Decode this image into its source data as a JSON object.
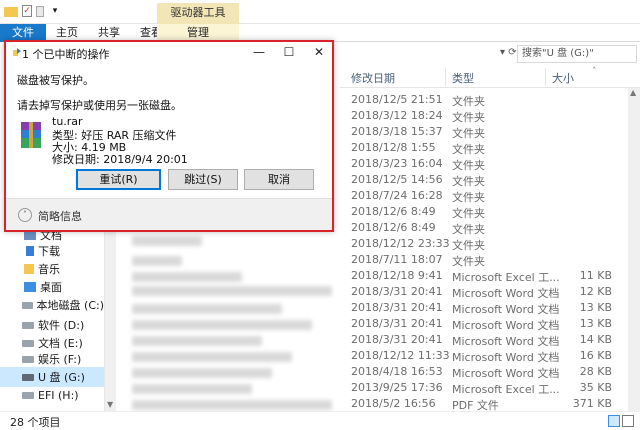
{
  "ribbon": {
    "context_label": "驱动器工具",
    "tabs": [
      "文件",
      "主页",
      "共享",
      "查看"
    ],
    "manage_tab": "管理"
  },
  "address": {
    "search_placeholder": "搜索\"U 盘 (G:)\""
  },
  "columns": {
    "date": "修改日期",
    "type": "类型",
    "size": "大小"
  },
  "files": [
    {
      "date": "2018/12/5 21:51",
      "type": "文件夹",
      "size": ""
    },
    {
      "date": "2018/3/12 18:24",
      "type": "文件夹",
      "size": ""
    },
    {
      "date": "2018/3/18 15:37",
      "type": "文件夹",
      "size": ""
    },
    {
      "date": "2018/12/8 1:55",
      "type": "文件夹",
      "size": ""
    },
    {
      "date": "2018/3/23 16:04",
      "type": "文件夹",
      "size": ""
    },
    {
      "date": "2018/12/5 14:56",
      "type": "文件夹",
      "size": ""
    },
    {
      "date": "2018/7/24 16:28",
      "type": "文件夹",
      "size": ""
    },
    {
      "date": "2018/12/6 8:49",
      "type": "文件夹",
      "size": ""
    },
    {
      "date": "2018/12/6 8:49",
      "type": "文件夹",
      "size": ""
    },
    {
      "date": "2018/12/12 23:33",
      "type": "文件夹",
      "size": ""
    },
    {
      "date": "2018/7/11 18:07",
      "type": "文件夹",
      "size": ""
    },
    {
      "date": "2018/12/18 9:41",
      "type": "Microsoft Excel 工...",
      "size": "11 KB"
    },
    {
      "date": "2018/3/31 20:41",
      "type": "Microsoft Word 文档",
      "size": "12 KB"
    },
    {
      "date": "2018/3/31 20:41",
      "type": "Microsoft Word 文档",
      "size": "13 KB"
    },
    {
      "date": "2018/3/31 20:41",
      "type": "Microsoft Word 文档",
      "size": "13 KB"
    },
    {
      "date": "2018/3/31 20:41",
      "type": "Microsoft Word 文档",
      "size": "14 KB"
    },
    {
      "date": "2018/12/12 11:33",
      "type": "Microsoft Word 文档",
      "size": "16 KB"
    },
    {
      "date": "2018/4/18 16:53",
      "type": "Microsoft Word 文档",
      "size": "28 KB"
    },
    {
      "date": "2013/9/25 17:36",
      "type": "Microsoft Excel 工...",
      "size": "35 KB"
    },
    {
      "date": "2018/5/2 16:56",
      "type": "PDF 文件",
      "size": "371 KB"
    }
  ],
  "nav": [
    {
      "label": "文档",
      "icon": "documents-icon"
    },
    {
      "label": "下载",
      "icon": "downloads-icon"
    },
    {
      "label": "音乐",
      "icon": "music-icon"
    },
    {
      "label": "桌面",
      "icon": "desktop-icon"
    },
    {
      "label": "本地磁盘 (C:)",
      "icon": "drive-icon"
    },
    {
      "label": "软件 (D:)",
      "icon": "drive-icon"
    },
    {
      "label": "文档 (E:)",
      "icon": "drive-icon"
    },
    {
      "label": "娱乐 (F:)",
      "icon": "drive-icon"
    },
    {
      "label": "U 盘 (G:)",
      "icon": "usb-drive-icon"
    },
    {
      "label": "EFI (H:)",
      "icon": "drive-icon"
    }
  ],
  "status": {
    "item_count": "28 个项目"
  },
  "dialog": {
    "title": "1 个已中断的操作",
    "message1": "磁盘被写保护。",
    "message2": "请去掉写保护或使用另一张磁盘。",
    "file_name": "tu.rar",
    "file_type": "类型: 好压 RAR 压缩文件",
    "file_size": "大小: 4.19 MB",
    "file_date": "修改日期: 2018/9/4 20:01",
    "retry": "重试(R)",
    "skip": "跳过(S)",
    "cancel": "取消",
    "more_info": "简略信息"
  },
  "colors": {
    "file_tab": "#1979ca",
    "context_tab": "#f2e6b6",
    "dialog_border": "#d9232a",
    "selected": "#cce8ff"
  }
}
